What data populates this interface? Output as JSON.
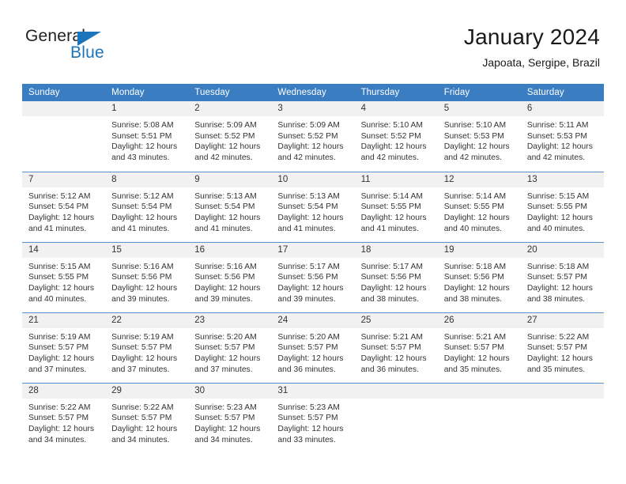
{
  "brand": {
    "name_part1": "General",
    "name_part2": "Blue",
    "triangle_color": "#1b75bb",
    "text_color": "#222222"
  },
  "header": {
    "month_title": "January 2024",
    "location": "Japoata, Sergipe, Brazil"
  },
  "theme": {
    "header_bg": "#3a7dc0",
    "header_text": "#ffffff",
    "daynum_band_bg": "#f1f1f1",
    "row_border": "#5b91c9",
    "body_text": "#333333"
  },
  "weekday_headers": [
    "Sunday",
    "Monday",
    "Tuesday",
    "Wednesday",
    "Thursday",
    "Friday",
    "Saturday"
  ],
  "weeks": [
    [
      {
        "day": "",
        "lines": []
      },
      {
        "day": "1",
        "lines": [
          "Sunrise: 5:08 AM",
          "Sunset: 5:51 PM",
          "Daylight: 12 hours",
          "and 43 minutes."
        ]
      },
      {
        "day": "2",
        "lines": [
          "Sunrise: 5:09 AM",
          "Sunset: 5:52 PM",
          "Daylight: 12 hours",
          "and 42 minutes."
        ]
      },
      {
        "day": "3",
        "lines": [
          "Sunrise: 5:09 AM",
          "Sunset: 5:52 PM",
          "Daylight: 12 hours",
          "and 42 minutes."
        ]
      },
      {
        "day": "4",
        "lines": [
          "Sunrise: 5:10 AM",
          "Sunset: 5:52 PM",
          "Daylight: 12 hours",
          "and 42 minutes."
        ]
      },
      {
        "day": "5",
        "lines": [
          "Sunrise: 5:10 AM",
          "Sunset: 5:53 PM",
          "Daylight: 12 hours",
          "and 42 minutes."
        ]
      },
      {
        "day": "6",
        "lines": [
          "Sunrise: 5:11 AM",
          "Sunset: 5:53 PM",
          "Daylight: 12 hours",
          "and 42 minutes."
        ]
      }
    ],
    [
      {
        "day": "7",
        "lines": [
          "Sunrise: 5:12 AM",
          "Sunset: 5:54 PM",
          "Daylight: 12 hours",
          "and 41 minutes."
        ]
      },
      {
        "day": "8",
        "lines": [
          "Sunrise: 5:12 AM",
          "Sunset: 5:54 PM",
          "Daylight: 12 hours",
          "and 41 minutes."
        ]
      },
      {
        "day": "9",
        "lines": [
          "Sunrise: 5:13 AM",
          "Sunset: 5:54 PM",
          "Daylight: 12 hours",
          "and 41 minutes."
        ]
      },
      {
        "day": "10",
        "lines": [
          "Sunrise: 5:13 AM",
          "Sunset: 5:54 PM",
          "Daylight: 12 hours",
          "and 41 minutes."
        ]
      },
      {
        "day": "11",
        "lines": [
          "Sunrise: 5:14 AM",
          "Sunset: 5:55 PM",
          "Daylight: 12 hours",
          "and 41 minutes."
        ]
      },
      {
        "day": "12",
        "lines": [
          "Sunrise: 5:14 AM",
          "Sunset: 5:55 PM",
          "Daylight: 12 hours",
          "and 40 minutes."
        ]
      },
      {
        "day": "13",
        "lines": [
          "Sunrise: 5:15 AM",
          "Sunset: 5:55 PM",
          "Daylight: 12 hours",
          "and 40 minutes."
        ]
      }
    ],
    [
      {
        "day": "14",
        "lines": [
          "Sunrise: 5:15 AM",
          "Sunset: 5:55 PM",
          "Daylight: 12 hours",
          "and 40 minutes."
        ]
      },
      {
        "day": "15",
        "lines": [
          "Sunrise: 5:16 AM",
          "Sunset: 5:56 PM",
          "Daylight: 12 hours",
          "and 39 minutes."
        ]
      },
      {
        "day": "16",
        "lines": [
          "Sunrise: 5:16 AM",
          "Sunset: 5:56 PM",
          "Daylight: 12 hours",
          "and 39 minutes."
        ]
      },
      {
        "day": "17",
        "lines": [
          "Sunrise: 5:17 AM",
          "Sunset: 5:56 PM",
          "Daylight: 12 hours",
          "and 39 minutes."
        ]
      },
      {
        "day": "18",
        "lines": [
          "Sunrise: 5:17 AM",
          "Sunset: 5:56 PM",
          "Daylight: 12 hours",
          "and 38 minutes."
        ]
      },
      {
        "day": "19",
        "lines": [
          "Sunrise: 5:18 AM",
          "Sunset: 5:56 PM",
          "Daylight: 12 hours",
          "and 38 minutes."
        ]
      },
      {
        "day": "20",
        "lines": [
          "Sunrise: 5:18 AM",
          "Sunset: 5:57 PM",
          "Daylight: 12 hours",
          "and 38 minutes."
        ]
      }
    ],
    [
      {
        "day": "21",
        "lines": [
          "Sunrise: 5:19 AM",
          "Sunset: 5:57 PM",
          "Daylight: 12 hours",
          "and 37 minutes."
        ]
      },
      {
        "day": "22",
        "lines": [
          "Sunrise: 5:19 AM",
          "Sunset: 5:57 PM",
          "Daylight: 12 hours",
          "and 37 minutes."
        ]
      },
      {
        "day": "23",
        "lines": [
          "Sunrise: 5:20 AM",
          "Sunset: 5:57 PM",
          "Daylight: 12 hours",
          "and 37 minutes."
        ]
      },
      {
        "day": "24",
        "lines": [
          "Sunrise: 5:20 AM",
          "Sunset: 5:57 PM",
          "Daylight: 12 hours",
          "and 36 minutes."
        ]
      },
      {
        "day": "25",
        "lines": [
          "Sunrise: 5:21 AM",
          "Sunset: 5:57 PM",
          "Daylight: 12 hours",
          "and 36 minutes."
        ]
      },
      {
        "day": "26",
        "lines": [
          "Sunrise: 5:21 AM",
          "Sunset: 5:57 PM",
          "Daylight: 12 hours",
          "and 35 minutes."
        ]
      },
      {
        "day": "27",
        "lines": [
          "Sunrise: 5:22 AM",
          "Sunset: 5:57 PM",
          "Daylight: 12 hours",
          "and 35 minutes."
        ]
      }
    ],
    [
      {
        "day": "28",
        "lines": [
          "Sunrise: 5:22 AM",
          "Sunset: 5:57 PM",
          "Daylight: 12 hours",
          "and 34 minutes."
        ]
      },
      {
        "day": "29",
        "lines": [
          "Sunrise: 5:22 AM",
          "Sunset: 5:57 PM",
          "Daylight: 12 hours",
          "and 34 minutes."
        ]
      },
      {
        "day": "30",
        "lines": [
          "Sunrise: 5:23 AM",
          "Sunset: 5:57 PM",
          "Daylight: 12 hours",
          "and 34 minutes."
        ]
      },
      {
        "day": "31",
        "lines": [
          "Sunrise: 5:23 AM",
          "Sunset: 5:57 PM",
          "Daylight: 12 hours",
          "and 33 minutes."
        ]
      },
      {
        "day": "",
        "lines": []
      },
      {
        "day": "",
        "lines": []
      },
      {
        "day": "",
        "lines": []
      }
    ]
  ]
}
